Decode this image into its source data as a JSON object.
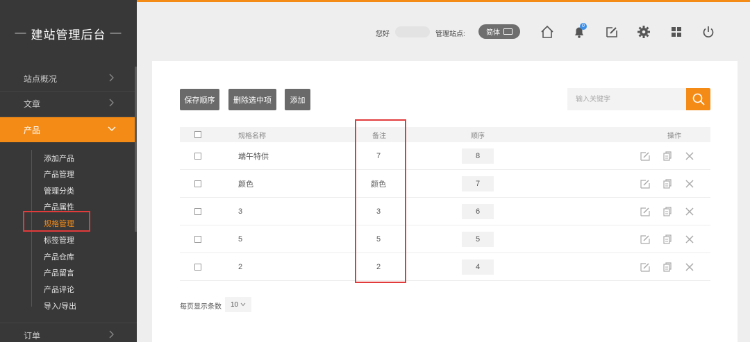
{
  "sidebar": {
    "logo_dash_left": "—",
    "logo_text": "建站管理后台",
    "logo_dash_right": "—",
    "items": [
      {
        "label": "站点概况"
      },
      {
        "label": "文章"
      },
      {
        "label": "产品"
      },
      {
        "label": "订单"
      }
    ],
    "sub_items": [
      {
        "label": "添加产品"
      },
      {
        "label": "产品管理"
      },
      {
        "label": "管理分类"
      },
      {
        "label": "产品属性"
      },
      {
        "label": "规格管理"
      },
      {
        "label": "标签管理"
      },
      {
        "label": "产品仓库"
      },
      {
        "label": "产品留言"
      },
      {
        "label": "产品评论"
      },
      {
        "label": "导入/导出"
      }
    ]
  },
  "header": {
    "greeting": "您好",
    "site_label": "管理站点:",
    "language": "简体",
    "notification_count": "0",
    "icons": [
      "home-icon",
      "bell-icon",
      "edit-icon",
      "gear-icon",
      "grid-icon",
      "power-icon"
    ]
  },
  "toolbar": {
    "save_order": "保存顺序",
    "delete_selected": "删除选中项",
    "add": "添加",
    "search_placeholder": "输入关键字"
  },
  "table": {
    "headers": {
      "name": "规格名称",
      "remark": "备注",
      "order": "顺序",
      "actions": "操作"
    },
    "rows": [
      {
        "name": "端午特供",
        "remark": "7",
        "order": "8"
      },
      {
        "name": "颜色",
        "remark": "颜色",
        "order": "7"
      },
      {
        "name": "3",
        "remark": "3",
        "order": "6"
      },
      {
        "name": "5",
        "remark": "5",
        "order": "5"
      },
      {
        "name": "2",
        "remark": "2",
        "order": "4"
      }
    ]
  },
  "pager": {
    "label": "每页显示条数",
    "per_page": "10"
  },
  "colors": {
    "accent": "#f48b16",
    "sidebar": "#383838",
    "highlight": "#e23b3b"
  }
}
